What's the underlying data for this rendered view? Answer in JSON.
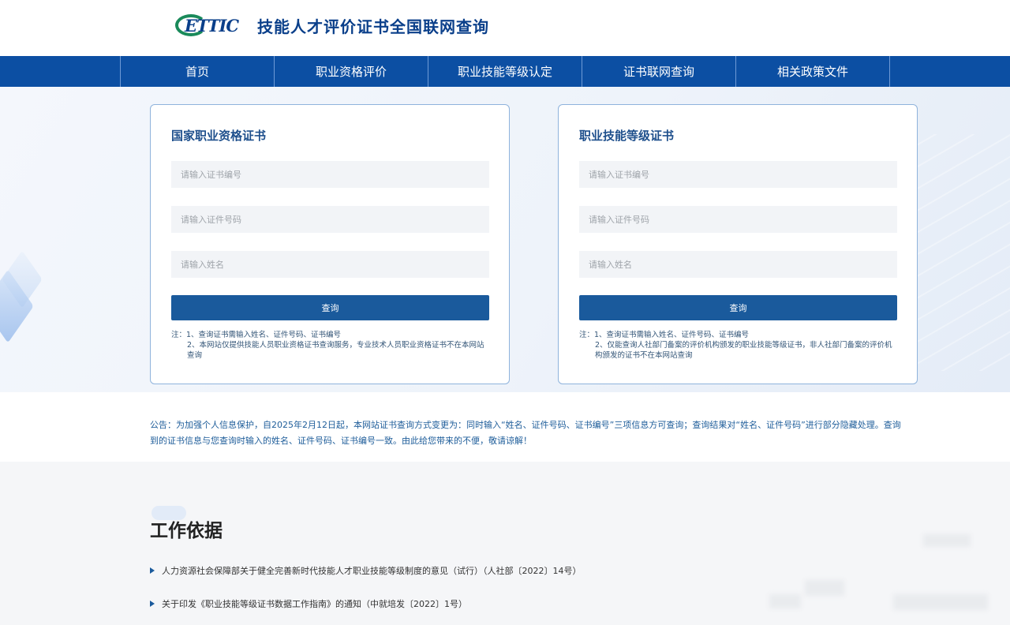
{
  "header": {
    "logo_text": "ETTIC",
    "site_title": "技能人才评价证书全国联网查询"
  },
  "nav": {
    "items": [
      {
        "label": "首页"
      },
      {
        "label": "职业资格评价"
      },
      {
        "label": "职业技能等级认定"
      },
      {
        "label": "证书联网查询"
      },
      {
        "label": "相关政策文件"
      }
    ]
  },
  "cards": {
    "left": {
      "title": "国家职业资格证书",
      "cert_no_placeholder": "请输入证书编号",
      "id_no_placeholder": "请输入证件号码",
      "name_placeholder": "请输入姓名",
      "button": "查询",
      "note1": "注：1、查询证书需输入姓名、证件号码、证书编号",
      "note2": "2、本网站仅提供技能人员职业资格证书查询服务，专业技术人员职业资格证书不在本网站查询"
    },
    "right": {
      "title": "职业技能等级证书",
      "cert_no_placeholder": "请输入证书编号",
      "id_no_placeholder": "请输入证件号码",
      "name_placeholder": "请输入姓名",
      "button": "查询",
      "note1": "注：1、查询证书需输入姓名、证件号码、证书编号",
      "note2": "2、仅能查询人社部门备案的评价机构颁发的职业技能等级证书，非人社部门备案的评价机构颁发的证书不在本网站查询"
    }
  },
  "announcement": "公告：为加强个人信息保护，自2025年2月12日起，本网站证书查询方式变更为：同时输入“姓名、证件号码、证书编号”三项信息方可查询；查询结果对“姓名、证件号码”进行部分隐藏处理。查询到的证书信息与您查询时输入的姓名、证件号码、证书编号一致。由此给您带来的不便，敬请谅解！",
  "basis": {
    "title": "工作依据",
    "items": [
      {
        "text": "人力资源社会保障部关于健全完善新时代技能人才职业技能等级制度的意见（试行）（人社部〔2022〕14号）"
      },
      {
        "text": "关于印发《职业技能等级证书数据工作指南》的通知（中就培发〔2022〕1号）"
      }
    ]
  },
  "colors": {
    "nav_bg": "#0c4fa3",
    "button_bg": "#1a5a9c",
    "title_blue": "#1e4f8c",
    "announce_text": "#1e5d9a"
  }
}
